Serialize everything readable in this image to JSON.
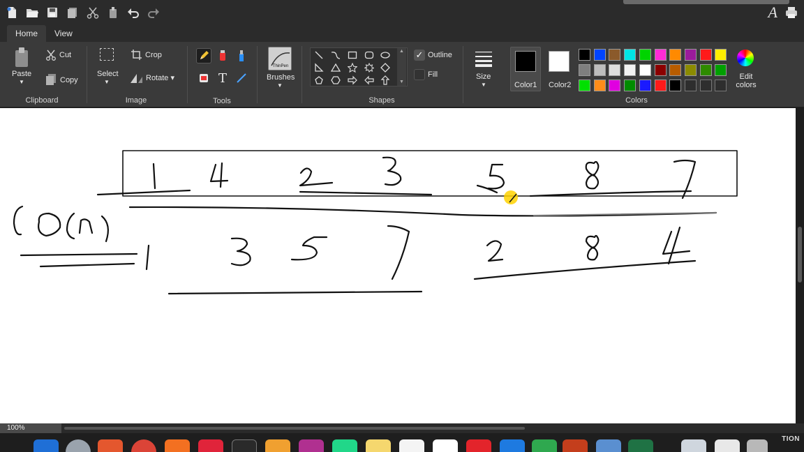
{
  "tabs": {
    "home": "Home",
    "view": "View"
  },
  "clipboard": {
    "paste": "Paste",
    "cut": "Cut",
    "copy": "Copy",
    "group": "Clipboard"
  },
  "image": {
    "select": "Select",
    "crop": "Crop",
    "rotate": "Rotate",
    "group": "Image"
  },
  "tools": {
    "group": "Tools",
    "text_tool": "T"
  },
  "brushes": {
    "label": "Brushes",
    "preview_text": "ThinPen"
  },
  "shapes": {
    "outline": "Outline",
    "fill": "Fill",
    "group": "Shapes"
  },
  "size": {
    "label": "Size"
  },
  "colors": {
    "color1_label": "Color1",
    "color2_label": "Color2",
    "color1": "#000000",
    "color2": "#ffffff",
    "edit_label": "Edit colors",
    "group": "Colors",
    "palette_row1": [
      "#000000",
      "#0044ff",
      "#8b5a2b",
      "#00e5e5",
      "#00d400",
      "#ff2bd6",
      "#ff8a00",
      "#9b1b9b",
      "#ff1a1a",
      "#ffee00"
    ],
    "palette_row2": [
      "#7f7f7f",
      "#bdbdbd",
      "#dedede",
      "#f2f2f2",
      "#ffffff",
      "#8b0000",
      "#b85c00",
      "#8b8b00",
      "#2e8b00",
      "#00a000"
    ],
    "palette_row3": [
      "#00e000",
      "#ff8c1a",
      "#e000e0",
      "#008c00",
      "#1a1aff",
      "#ff1a1a",
      "#000000",
      "",
      "",
      ""
    ]
  },
  "status": {
    "zoom": "100%"
  },
  "dock": {
    "corner_text": "TION"
  },
  "drawing": {
    "row1_numbers": [
      "1",
      "4",
      "2",
      "3",
      "5",
      "8",
      "7"
    ],
    "row2_numbers": [
      "1",
      "3",
      "5",
      "7",
      "2",
      "8",
      "4"
    ],
    "complexity_note": "O(n)"
  }
}
